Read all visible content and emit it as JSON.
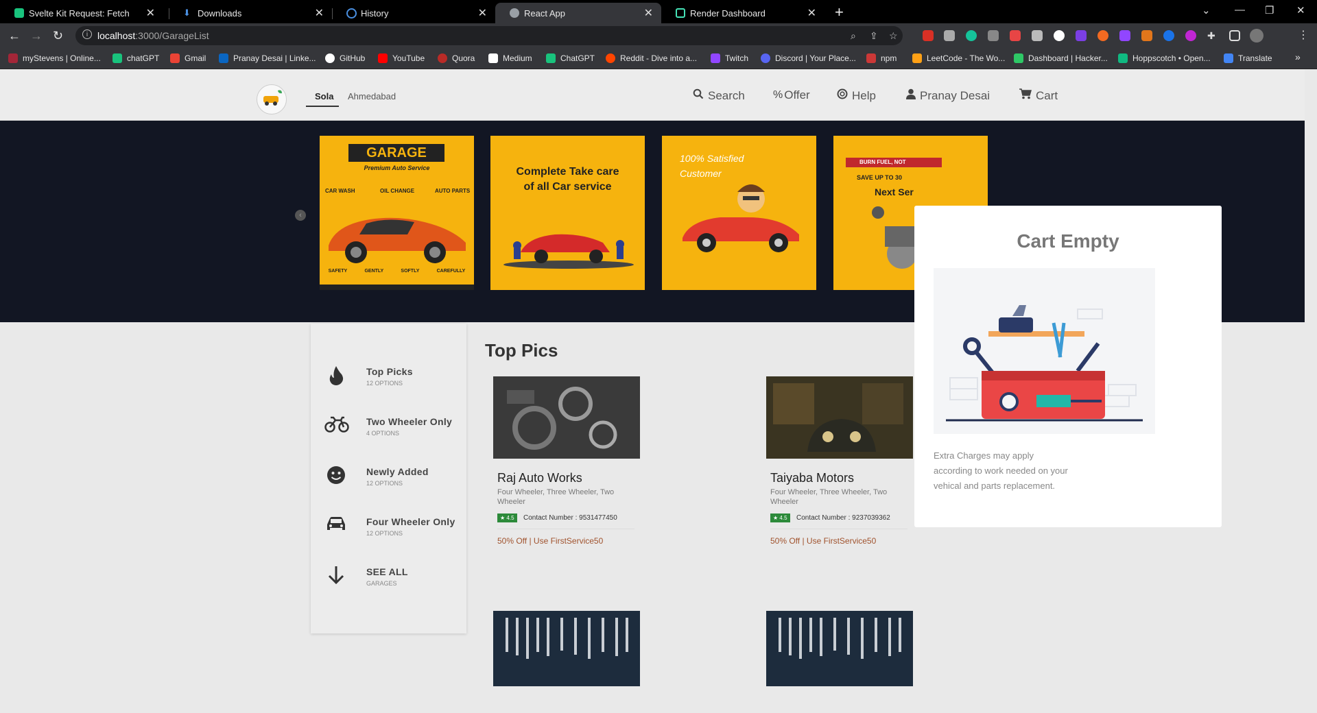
{
  "browser": {
    "tabs": [
      {
        "label": "Svelte Kit Request: Fetch",
        "icon": "chatgpt-icon",
        "color": "#19c37d",
        "active": false
      },
      {
        "label": "Downloads",
        "icon": "download-icon",
        "color": "#4285f4",
        "active": false
      },
      {
        "label": "History",
        "icon": "history-icon",
        "color": "#4285f4",
        "active": false
      },
      {
        "label": "React App",
        "icon": "chatgpt-icon",
        "color": "#9aa0a6",
        "active": true
      },
      {
        "label": "Render Dashboard",
        "icon": "render-icon",
        "color": "#46e3b7",
        "active": false
      }
    ],
    "url_host": "localhost",
    "url_path": ":3000/GarageList",
    "bookmarks": [
      {
        "label": "myStevens | Online...",
        "color": "#a32638"
      },
      {
        "label": "chatGPT",
        "color": "#19c37d"
      },
      {
        "label": "Gmail",
        "color": "#ea4335"
      },
      {
        "label": "Pranay Desai | Linke...",
        "color": "#0a66c2"
      },
      {
        "label": "GitHub",
        "color": "#ffffff"
      },
      {
        "label": "YouTube",
        "color": "#ff0000"
      },
      {
        "label": "Quora",
        "color": "#b92b27"
      },
      {
        "label": "Medium",
        "color": "#ffffff"
      },
      {
        "label": "ChatGPT",
        "color": "#19c37d"
      },
      {
        "label": "Reddit - Dive into a...",
        "color": "#ff4500"
      },
      {
        "label": "Twitch",
        "color": "#9146ff"
      },
      {
        "label": "Discord | Your Place...",
        "color": "#5865f2"
      },
      {
        "label": "npm",
        "color": "#cb3837"
      },
      {
        "label": "LeetCode - The Wo...",
        "color": "#ffa116"
      },
      {
        "label": "Dashboard | Hacker...",
        "color": "#2ec866"
      },
      {
        "label": "Hoppscotch • Open...",
        "color": "#10b981"
      },
      {
        "label": "Translate",
        "color": "#4285f4"
      }
    ]
  },
  "site": {
    "locations": [
      "Sola",
      "Ahmedabad"
    ],
    "nav": {
      "search": "Search",
      "offer": "Offer",
      "help": "Help",
      "user": "Pranay Desai",
      "cart": "Cart"
    },
    "banners": [
      {
        "title": "GARAGE",
        "subtitle": "Premium Auto Service",
        "tags": [
          "CAR WASH",
          "OIL CHANGE",
          "AUTO PARTS"
        ],
        "footer": [
          "SAFETY",
          "GENTLY",
          "SOFTLY",
          "CAREFULLY"
        ]
      },
      {
        "title": "Complete Take care of all Car service"
      },
      {
        "title": "100% Satisfied Customer"
      },
      {
        "title": "BURN FUEL, NOT",
        "subtitle": "SAVE UP TO 30",
        "footer": "Next Ser"
      }
    ],
    "sidebar": [
      {
        "title": "Top Picks",
        "sub": "12 OPTIONS",
        "icon": "fire-icon"
      },
      {
        "title": "Two Wheeler Only",
        "sub": "4 OPTIONS",
        "icon": "bicycle-icon"
      },
      {
        "title": "Newly Added",
        "sub": "12 OPTIONS",
        "icon": "smile-icon"
      },
      {
        "title": "Four Wheeler Only",
        "sub": "12 OPTIONS",
        "icon": "car-icon"
      },
      {
        "title": "SEE ALL",
        "sub": "GARAGES",
        "icon": "arrow-down-icon"
      }
    ],
    "section_title": "Top Pics",
    "garages": [
      {
        "name": "Raj Auto Works",
        "types": "Four Wheeler, Three Wheeler, Two Wheeler",
        "rating": "4.5",
        "contact": "Contact Number : 9531477450",
        "offer": "50% Off | Use FirstService50"
      },
      {
        "name": "Taiyaba Motors",
        "types": "Four Wheeler, Three Wheeler, Two Wheeler",
        "rating": "4.5",
        "contact": "Contact Number : 9237039362",
        "offer": "50% Off | Use FirstService50"
      }
    ],
    "cart_modal": {
      "title": "Cart Empty",
      "note": "Extra Charges may apply according to work needed on your vehical and parts replacement."
    }
  }
}
